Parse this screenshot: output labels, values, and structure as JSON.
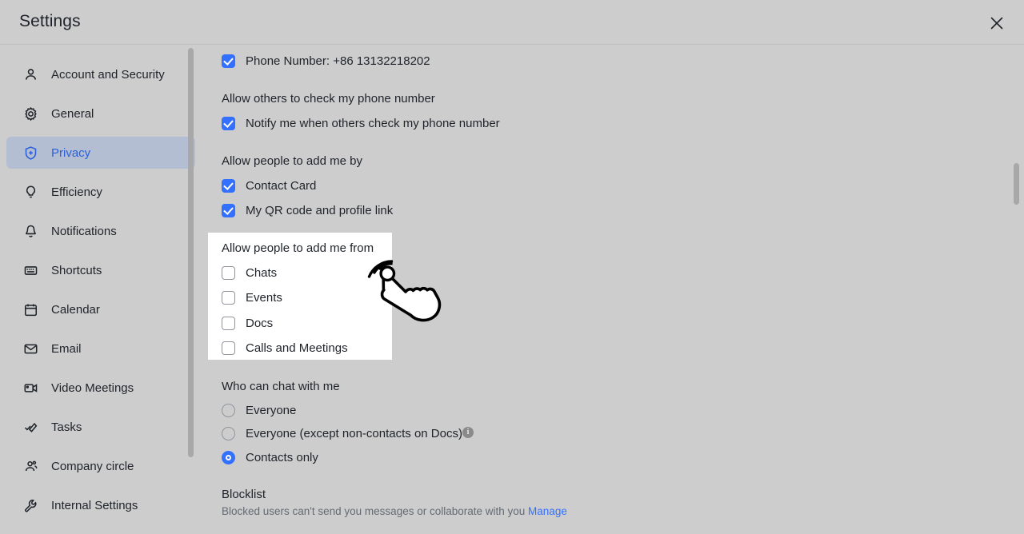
{
  "window": {
    "title": "Settings",
    "close_label": "Close"
  },
  "sidebar": {
    "items": [
      {
        "label": "Account and Security",
        "icon": "person-icon",
        "active": false
      },
      {
        "label": "General",
        "icon": "gear-icon",
        "active": false
      },
      {
        "label": "Privacy",
        "icon": "shield-plus-icon",
        "active": true
      },
      {
        "label": "Efficiency",
        "icon": "lightbulb-icon",
        "active": false
      },
      {
        "label": "Notifications",
        "icon": "bell-icon",
        "active": false
      },
      {
        "label": "Shortcuts",
        "icon": "keyboard-icon",
        "active": false
      },
      {
        "label": "Calendar",
        "icon": "calendar-icon",
        "active": false
      },
      {
        "label": "Email",
        "icon": "envelope-icon",
        "active": false
      },
      {
        "label": "Video Meetings",
        "icon": "video-camera-icon",
        "active": false
      },
      {
        "label": "Tasks",
        "icon": "check-pen-icon",
        "active": false
      },
      {
        "label": "Company circle",
        "icon": "people-icon",
        "active": false
      },
      {
        "label": "Internal Settings",
        "icon": "wrench-icon",
        "active": false
      }
    ]
  },
  "main": {
    "phone_number_row": {
      "label": "Phone Number: +86 13132218202",
      "checked": true
    },
    "check_phone_group": {
      "label": "Allow others to check my phone number",
      "option": {
        "label": "Notify me when others check my phone number",
        "checked": true
      }
    },
    "add_me_by_group": {
      "label": "Allow people to add me by",
      "options": [
        {
          "label": "Contact Card",
          "checked": true
        },
        {
          "label": "My QR code and profile link",
          "checked": true
        }
      ]
    },
    "add_me_from_group": {
      "label": "Allow people to add me from",
      "options": [
        {
          "label": "Chats",
          "checked": false
        },
        {
          "label": "Events",
          "checked": false
        },
        {
          "label": "Docs",
          "checked": false
        },
        {
          "label": "Calls and Meetings",
          "checked": false
        }
      ]
    },
    "who_can_chat_group": {
      "label": "Who can chat with me",
      "options": [
        {
          "label": "Everyone",
          "selected": false,
          "info": false
        },
        {
          "label": "Everyone (except non-contacts on Docs)",
          "selected": false,
          "info": true
        },
        {
          "label": "Contacts only",
          "selected": true,
          "info": false
        }
      ],
      "info_glyph": "i"
    },
    "blocklist": {
      "title": "Blocklist",
      "description": "Blocked users can't send you messages or collaborate with you",
      "link_label": "Manage"
    }
  },
  "colors": {
    "accent": "#3370ff",
    "accent_nav": "#2b5fd9",
    "background": "#cdcdcd",
    "panel_highlight": "#ffffff",
    "nav_active_bg": "#b4bed2",
    "text_primary": "#1f2329",
    "text_secondary": "#646a73"
  }
}
